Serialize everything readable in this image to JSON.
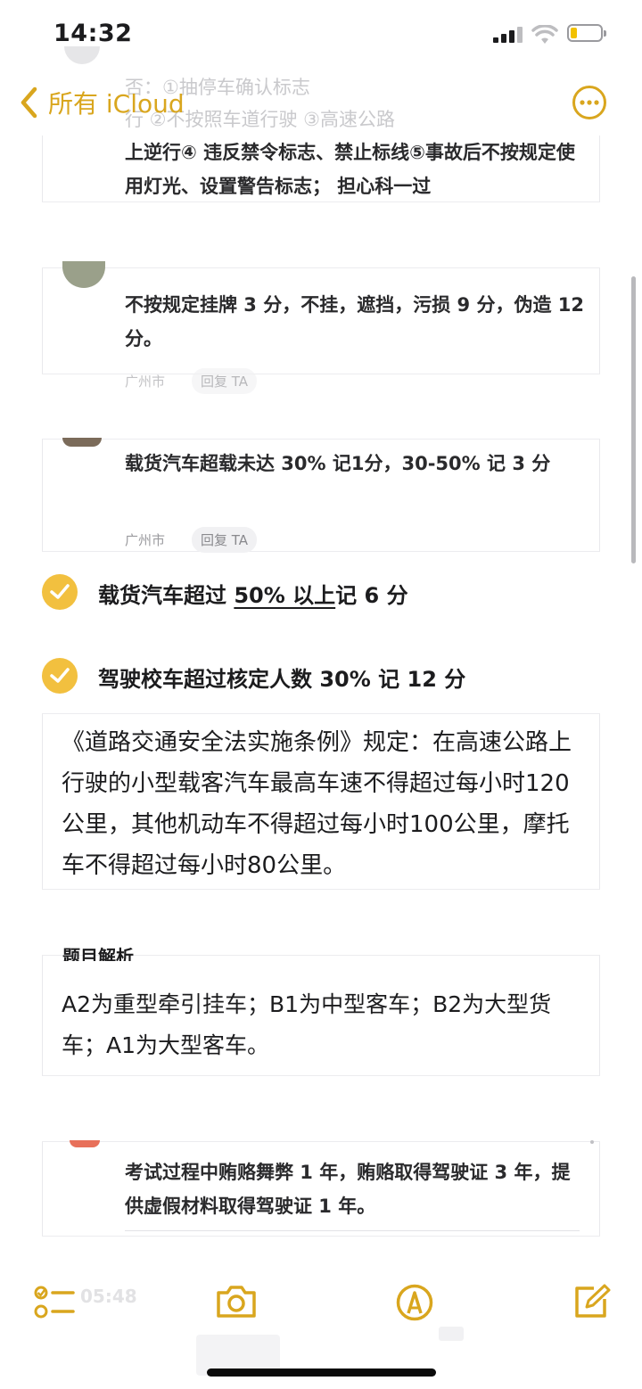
{
  "status": {
    "time": "14:32"
  },
  "nav": {
    "back_label": "所有 iCloud"
  },
  "ghost_top": {
    "line1": "否：①抽停车确认标志",
    "line2": "行 ②不按照车道行驶 ③高速公路"
  },
  "cards": [
    {
      "text": "上逆行④ 违反禁令标志、禁止标线⑤事故后不按规定使用灯光、设置警告标志； 担心科一过"
    },
    {
      "text": "不按规定挂牌 3 分，不挂，遮挡，污损 9 分，伪造 12 分。",
      "location": "广州市",
      "reply": "回复 TA"
    },
    {
      "text": "载货汽车超载未达 30% 记1分，30-50% 记 3 分",
      "location": "广州市",
      "reply": "回复 TA"
    }
  ],
  "checklist": [
    {
      "pre": "载货汽车超过 ",
      "underlined": "50% 以上",
      "post": "记 6 分"
    },
    {
      "pre": "驾驶校车超过核定人数 30% 记 12 分",
      "underlined": "",
      "post": ""
    }
  ],
  "law_note": "《道路交通安全法实施条例》规定：在高速公路上行驶的小型载客汽车最高车速不得超过每小时120公里，其他机动车不得超过每小时100公里，摩托车不得超过每小时80公里。",
  "analysis_card": {
    "header_fragment": "题目解析",
    "text": "A2为重型牵引挂车；B1为中型客车；B2为大型货车；A1为大型客车。"
  },
  "exam_card": {
    "text": "考试过程中贿赂舞弊 1 年，贿赂取得驾驶证 3 年，提供虚假材料取得驾驶证 1 年。"
  },
  "toolbar": {
    "icons": [
      "checklist-icon",
      "camera-icon",
      "markup-icon",
      "compose-icon"
    ],
    "ghost_time": "05:48"
  },
  "colors": {
    "accent": "#d9a61e",
    "check": "#f2c03f"
  }
}
